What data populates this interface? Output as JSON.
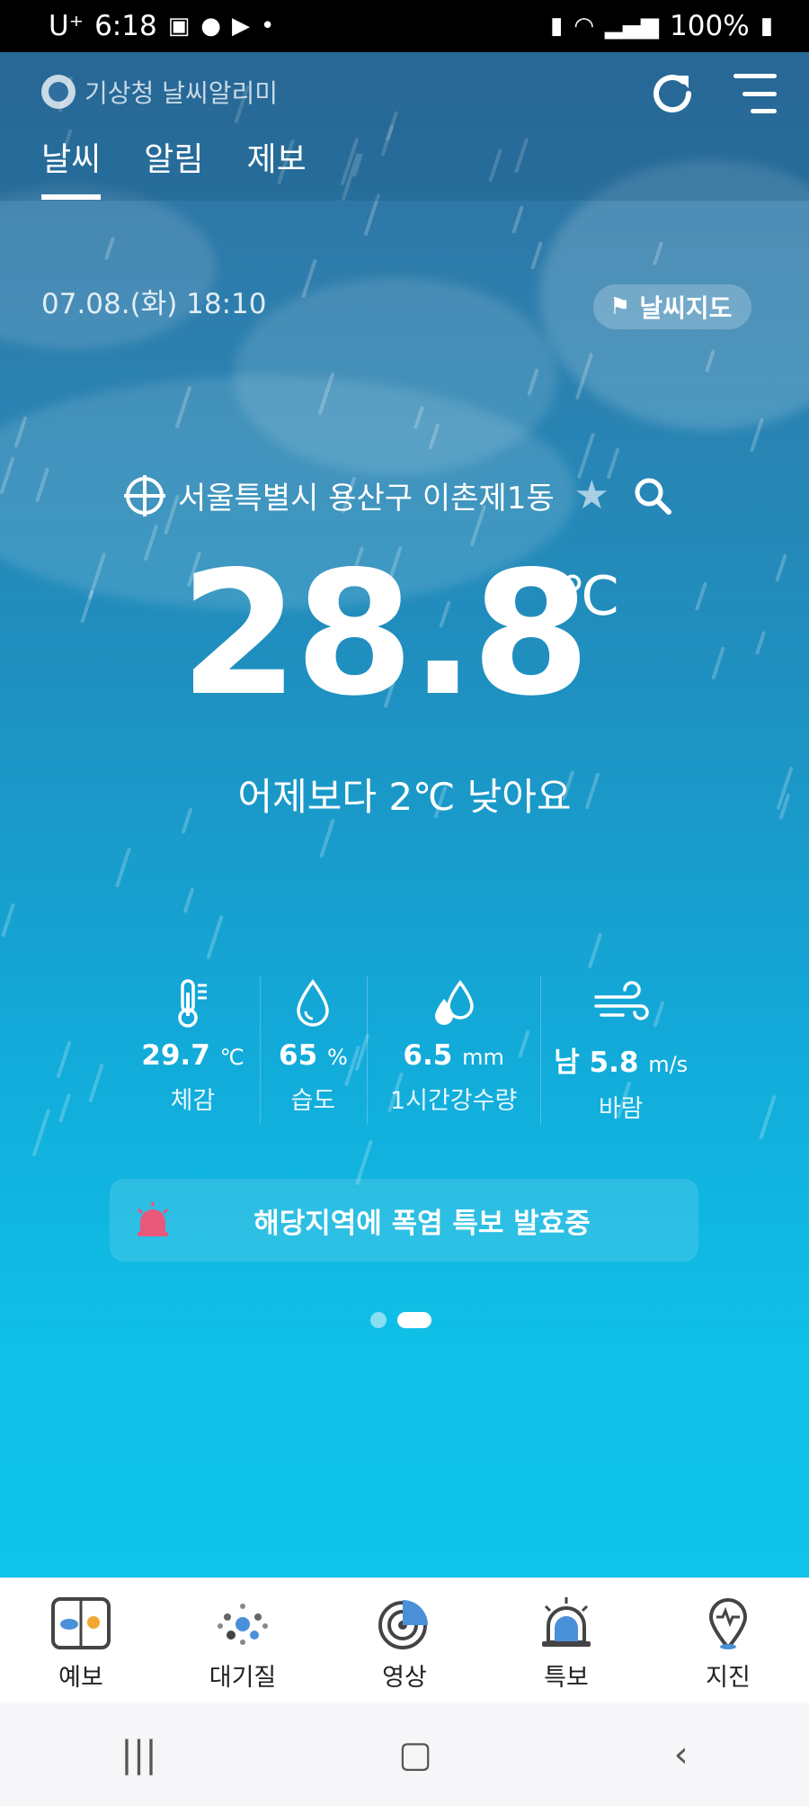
{
  "status_bar": {
    "carrier": "U⁺",
    "time": "6:18",
    "battery": "100%"
  },
  "header": {
    "app_name": "기상청 날씨알리미",
    "tabs": [
      {
        "label": "날씨",
        "active": true
      },
      {
        "label": "알림",
        "active": false
      },
      {
        "label": "제보",
        "active": false
      }
    ]
  },
  "weather": {
    "datetime": "07.08.(화) 18:10",
    "map_button": "날씨지도",
    "location": "서울특별시 용산구 이촌제1동",
    "temperature": "28.8",
    "temperature_unit": "℃",
    "comparison": "어제보다 2℃ 낮아요",
    "stats": [
      {
        "icon": "thermometer-icon",
        "value": "29.7",
        "unit": "℃",
        "label": "체감"
      },
      {
        "icon": "humidity-drop-icon",
        "value": "65",
        "unit": "%",
        "label": "습도"
      },
      {
        "icon": "rain-drops-icon",
        "value": "6.5",
        "unit": "mm",
        "label": "1시간강수량"
      },
      {
        "icon": "wind-icon",
        "value": "남 5.8",
        "unit": "m/s",
        "label": "바람"
      }
    ],
    "alert": "해당지역에 폭염 특보 발효중",
    "pager": {
      "count": 2,
      "active_index": 1
    }
  },
  "bottom_nav": [
    {
      "icon": "forecast-icon",
      "label": "예보"
    },
    {
      "icon": "air-quality-icon",
      "label": "대기질"
    },
    {
      "icon": "radar-icon",
      "label": "영상"
    },
    {
      "icon": "siren-icon",
      "label": "특보"
    },
    {
      "icon": "earthquake-pin-icon",
      "label": "지진"
    }
  ],
  "colors": {
    "bg_top": "#2e6f9f",
    "bg_bottom": "#0fc3ea",
    "alert_siren": "#e8587a",
    "nav_accent": "#4a90d9"
  }
}
